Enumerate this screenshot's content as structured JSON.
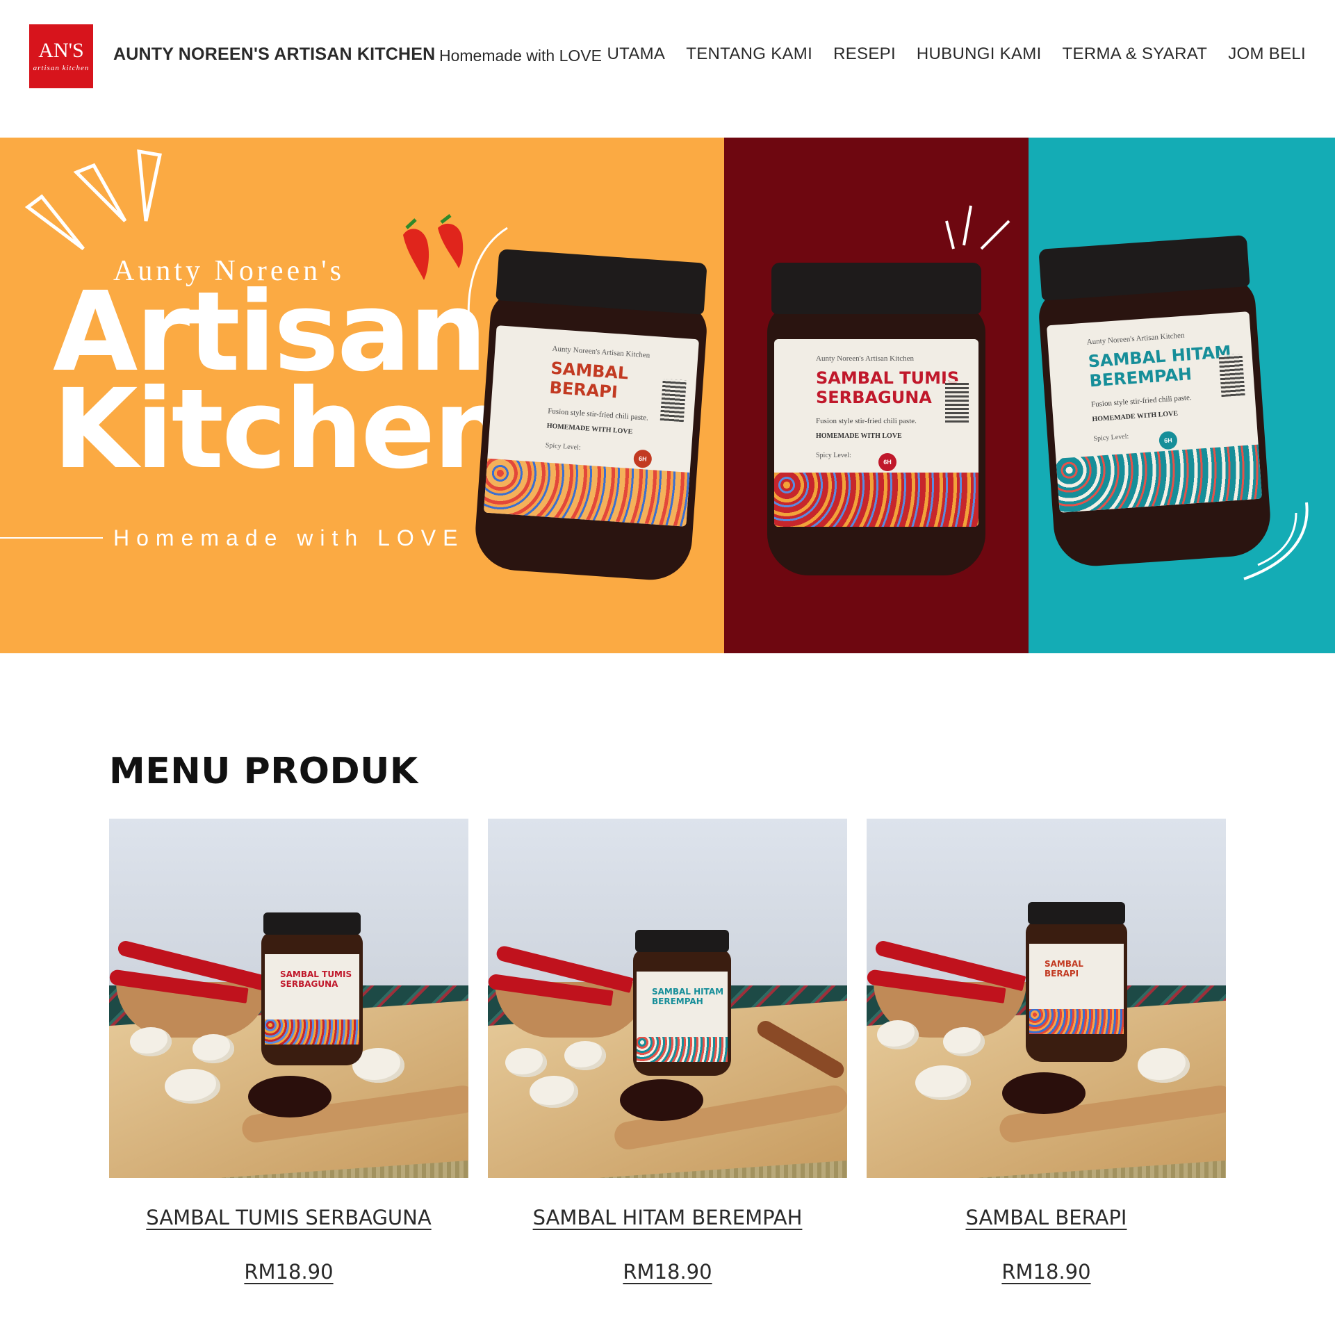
{
  "header": {
    "logo_text": "AN'S",
    "logo_subtext": "artisan kitchen",
    "site_title": "AUNTY NOREEN'S ARTISAN KITCHEN",
    "tagline": "Homemade with LOVE",
    "nav": [
      "UTAMA",
      "TENTANG KAMI",
      "RESEPI",
      "HUBUNGI KAMI",
      "TERMA & SYARAT",
      "JOM BELI"
    ]
  },
  "hero": {
    "brand": "Aunty Noreen's",
    "title_line1": "Artisan",
    "title_line2": "Kitchen",
    "tagline": "Homemade with LOVE",
    "colors": {
      "orange": "#fbaa43",
      "red": "#6e0710",
      "teal": "#14acb5"
    },
    "jars": [
      {
        "brand": "Aunty Noreen's Artisan Kitchen",
        "name": "SAMBAL\nBERAPI",
        "desc": "Fusion style stir-fried chili paste.",
        "love": "HOMEMADE WITH LOVE",
        "spicy": "Spicy Level:",
        "badge": "6H",
        "accent": "#c23a22"
      },
      {
        "brand": "Aunty Noreen's Artisan Kitchen",
        "name": "SAMBAL TUMIS\nSERBAGUNA",
        "desc": "Fusion style stir-fried chili paste.",
        "love": "HOMEMADE WITH LOVE",
        "spicy": "Spicy Level:",
        "badge": "6H",
        "accent": "#c0182b"
      },
      {
        "brand": "Aunty Noreen's Artisan Kitchen",
        "name": "SAMBAL HITAM\nBEREMPAH",
        "desc": "Fusion style stir-fried chili paste.",
        "love": "HOMEMADE WITH LOVE",
        "spicy": "Spicy Level:",
        "badge": "6H",
        "accent": "#168e99"
      }
    ]
  },
  "menu": {
    "title": "MENU PRODUK",
    "products": [
      {
        "name": "SAMBAL TUMIS SERBAGUNA",
        "price": "RM18.90",
        "jar_label": "SAMBAL TUMIS\nSERBAGUNA",
        "accent": "#c0182b"
      },
      {
        "name": "SAMBAL HITAM BEREMPAH",
        "price": "RM18.90",
        "jar_label": "SAMBAL HITAM\nBEREMPAH",
        "accent": "#168e99"
      },
      {
        "name": "SAMBAL BERAPI",
        "price": "RM18.90",
        "jar_label": "SAMBAL\nBERAPI",
        "accent": "#c23a22"
      }
    ]
  }
}
